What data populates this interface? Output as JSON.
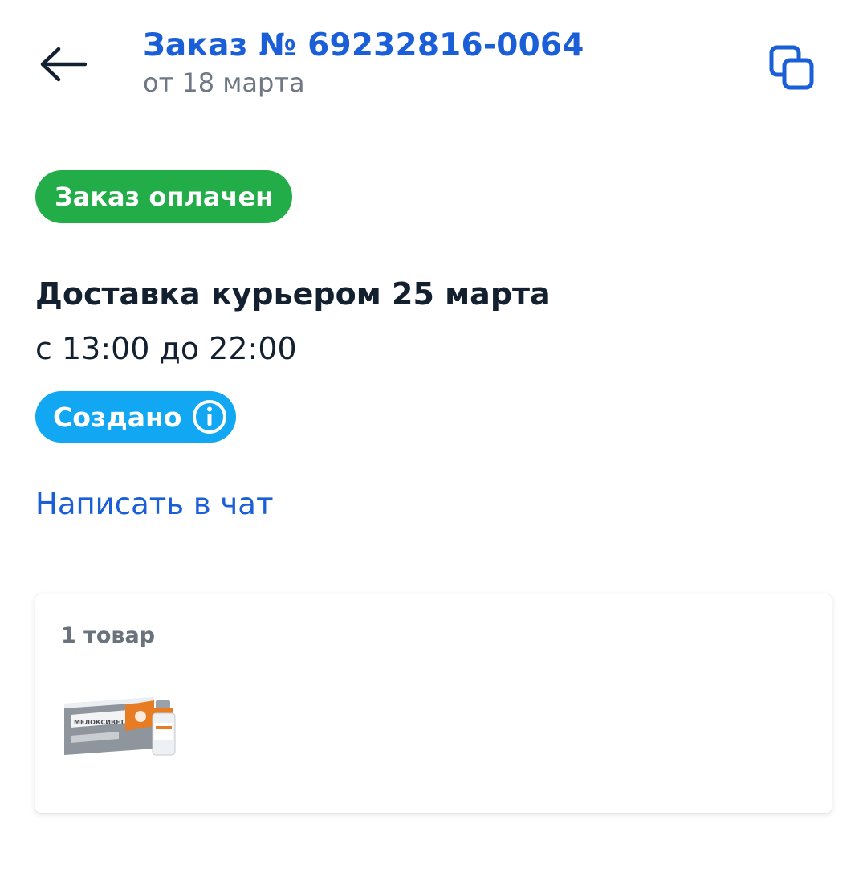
{
  "header": {
    "title": "Заказ № 69232816-0064",
    "subtitle": "от 18 марта",
    "back_icon": "arrow-left-icon",
    "copy_icon": "copy-icon"
  },
  "order": {
    "payment_status": "Заказ оплачен",
    "delivery_title": "Доставка курьером 25 марта",
    "delivery_time": "с 13:00 до 22:00",
    "status": "Создано",
    "chat_link": "Написать в чат"
  },
  "items": {
    "count_label": "1 товар",
    "products": [
      {
        "name": "МЕЛОКСИВЕТ 0,2%"
      }
    ]
  },
  "colors": {
    "accent_blue": "#1a5fd8",
    "paid_green": "#23ad49",
    "status_blue": "#11a7f2"
  }
}
